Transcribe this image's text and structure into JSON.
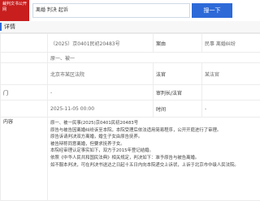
{
  "header": {
    "logo_text": "裁判文书公开网",
    "search_value": "离婚  判决 起诉",
    "search_button": "搜一下"
  },
  "section_title": "详情",
  "rows": [
    {
      "c1": "",
      "c2": "（2025）京0401民初20483号",
      "c3": "案由",
      "c4": "民事 离婚纠纷"
    },
    {
      "c1": "",
      "c2": "原一、被一",
      "c3": "",
      "c4": ""
    },
    {
      "c1": "",
      "c2": "北京市某区法院",
      "c3": "法官",
      "c4": "某法官"
    },
    {
      "c1": "门",
      "c2": "-",
      "c3": "审判长/法官",
      "c4": ""
    },
    {
      "c1": "",
      "c2": "2025-11-05 00:00",
      "c3": "时间",
      "c4": "-"
    }
  ],
  "content_label": "内容",
  "content_lines": [
    "原一、被一民事(2025)京0401民初20483号",
    "原告与被告因离婚纠纷诉至本院，本院受理后依法适用简易程序，公开开庭进行了审理。",
    "原告诉请判决双方离婚，婚生子女由原告抚养。",
    "被告辩称同意离婚，但要求抚养子女。",
    "本院经审理认定事实如下，双方于2015年登记结婚。",
    "依照《中华人民共和国民法典》相关规定，判决如下：准予原告与被告离婚。",
    "如不服本判决，可在判决书送达之日起十五日内向本院递交上诉状，上诉于北京市中级人民法院。"
  ]
}
